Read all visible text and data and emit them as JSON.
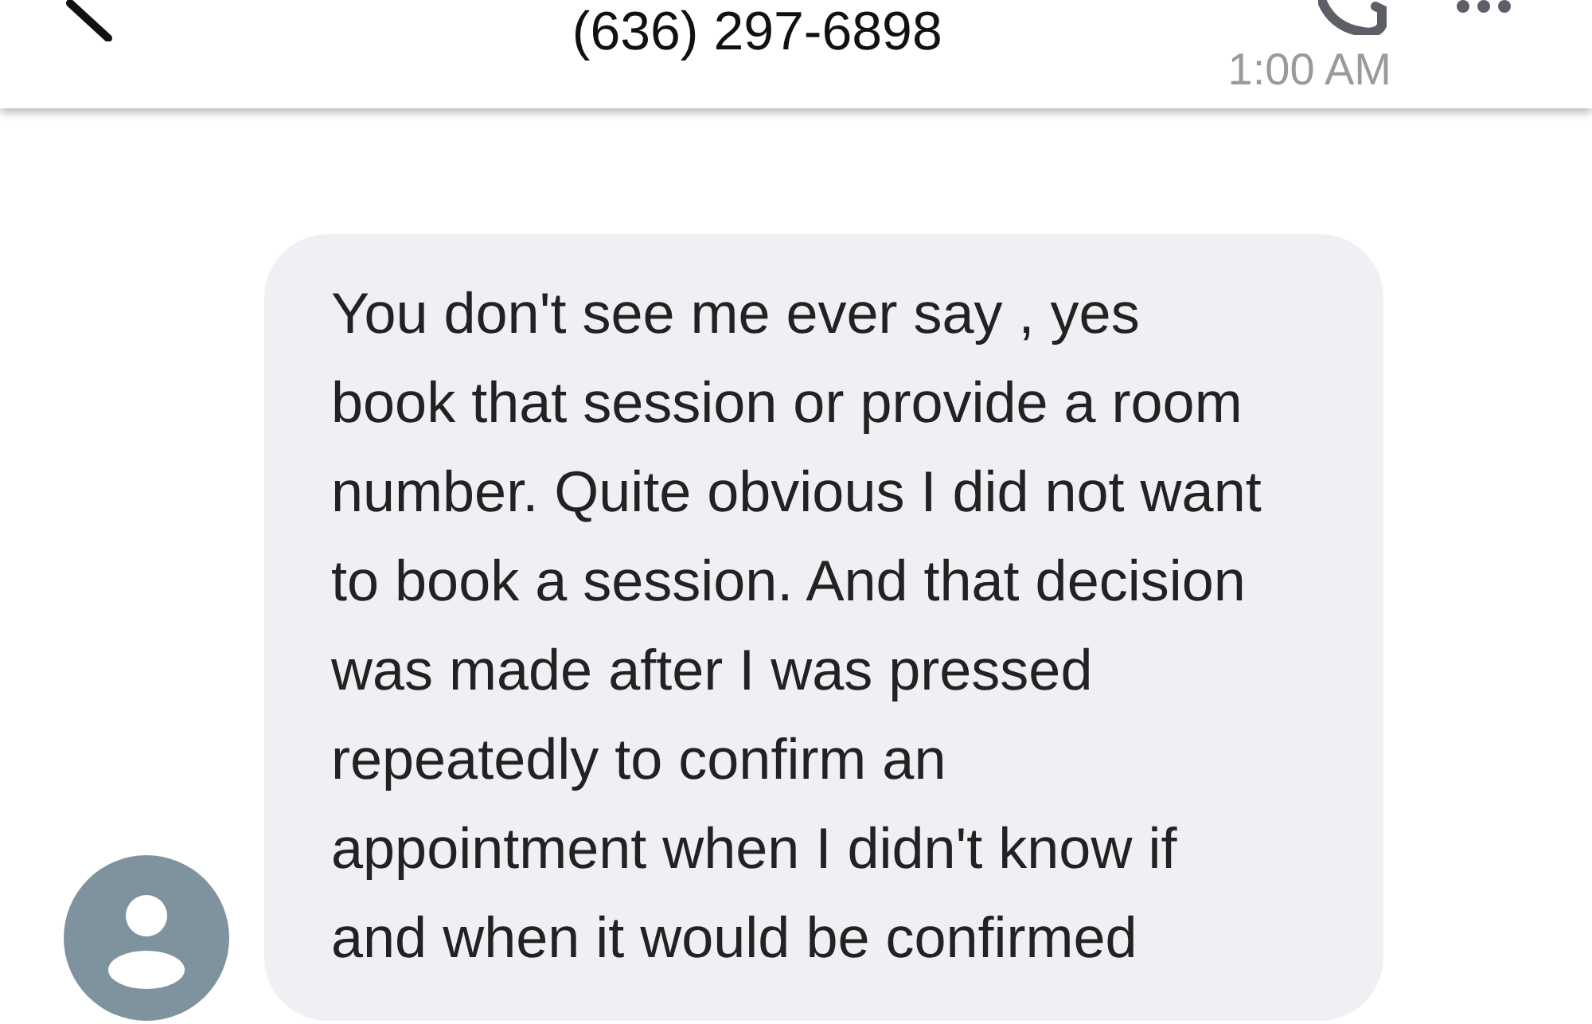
{
  "header": {
    "title": "(636) 297-6898",
    "time": "1:00 AM"
  },
  "messages": [
    {
      "text": "You don't see me ever say , yes book that session or provide a room number. Quite obvious I did not want to book a session. And that decision was made after I was pressed repeatedly to confirm an appointment when I didn't know if and when it would be confirmed"
    }
  ]
}
